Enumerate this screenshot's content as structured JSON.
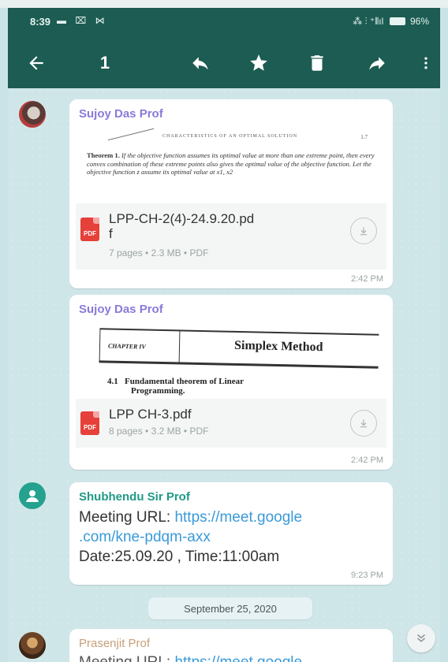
{
  "status_bar": {
    "time": "8:39",
    "left_icons": "▬ ⌧ ⋈",
    "right_icons": "⁂ ⫶ ⁺⫴ıl",
    "battery": "96%"
  },
  "toolbar": {
    "selected_count": "1"
  },
  "messages": [
    {
      "sender": "Sujoy Das Prof",
      "preview": {
        "header": "CHARACTERISTICS OF AN OPTIMAL SOLUTION",
        "page": "1.7",
        "theorem_label": "Theorem 1.",
        "body": "If the objective function assumes its optimal value at more than one extreme point, then every convex combination of these extreme points also gives the optimal value of the objective function. Let the objective function z assume its optimal value at x1, x2"
      },
      "file": {
        "name_line1": "LPP-CH-2(4)-24.9.20.pd",
        "name_line2": "f",
        "meta": "7 pages • 2.3 MB • PDF",
        "badge": "PDF"
      },
      "time": "2:42 PM"
    },
    {
      "sender": "Sujoy Das Prof",
      "preview": {
        "chapter": "CHAPTER IV",
        "title": "Simplex Method",
        "section_number": "4.1",
        "section_text_1": "Fundamental theorem of Linear",
        "section_text_2": "Programming."
      },
      "file": {
        "name": "LPP CH-3.pdf",
        "meta": "8 pages • 3.2 MB • PDF",
        "badge": "PDF"
      },
      "time": "2:42 PM"
    },
    {
      "sender": "Shubhendu Sir Prof",
      "text_prefix": "Meeting URL: ",
      "link_line1": "https://meet.google",
      "link_line2": ".com/kne-pdqm-axx",
      "date_line": "Date:25.09.20 , Time:11:00am",
      "time": "9:23 PM"
    },
    {
      "sender": "Prasenjit Prof",
      "text_prefix": "Meeting URL: ",
      "link_partial": "https://meet.google"
    }
  ],
  "date_divider": "September 25, 2020",
  "colors": {
    "appbar": "#1c5c52",
    "sender_1": "#8a7ad9",
    "sender_3": "#1f9a86",
    "sender_4": "#c7a07a",
    "link": "#3a9ad9"
  },
  "icons": {
    "back": "arrow-left-icon",
    "reply": "reply-icon",
    "star": "star-icon",
    "delete": "trash-icon",
    "forward": "forward-icon",
    "more": "more-vert-icon",
    "download": "download-icon",
    "scroll_down": "double-chevron-down-icon"
  }
}
